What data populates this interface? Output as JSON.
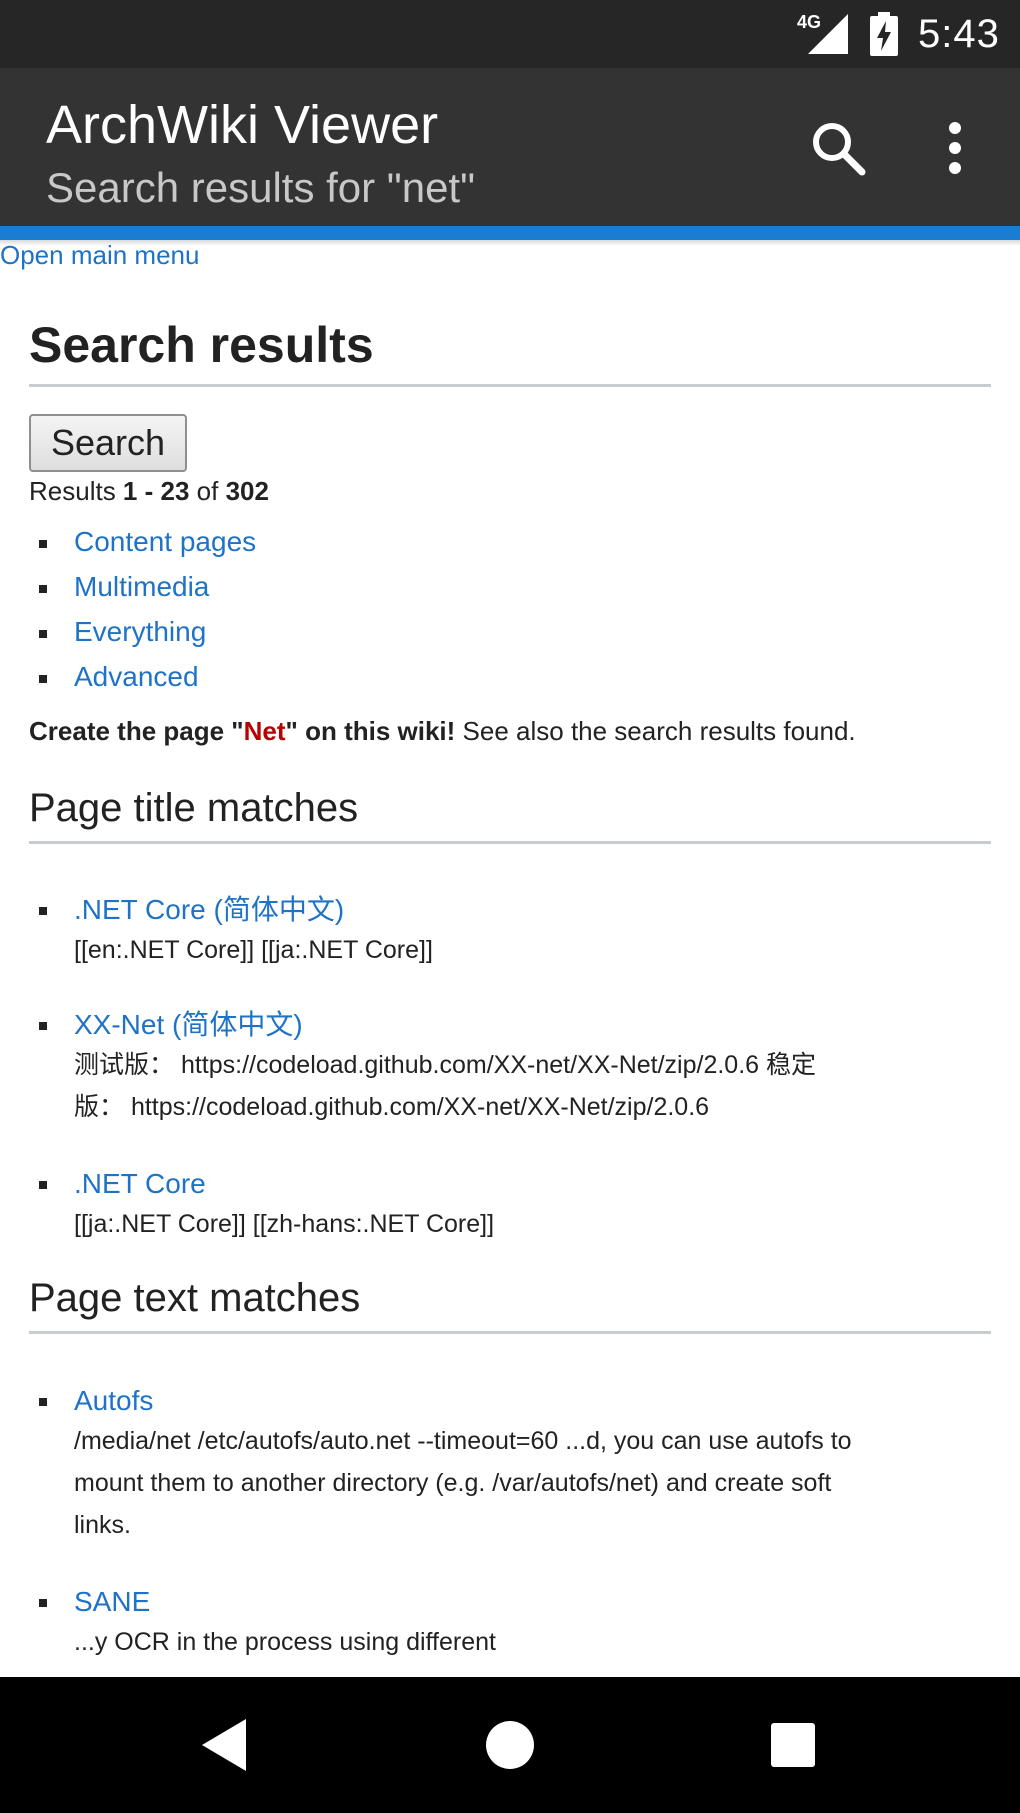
{
  "status_bar": {
    "network": "4G",
    "time": "5:43"
  },
  "app_bar": {
    "title": "ArchWiki Viewer",
    "subtitle": "Search results for \"net\"",
    "icons": [
      "search-icon",
      "more-vert-icon"
    ]
  },
  "content": {
    "open_main_menu": "Open main menu",
    "heading": "Search results",
    "search_button": "Search",
    "results": {
      "prefix": "Results ",
      "range": "1 - 23",
      "of": " of ",
      "total": "302"
    },
    "profiles": [
      {
        "label": "Content pages"
      },
      {
        "label": "Multimedia"
      },
      {
        "label": "Everything"
      },
      {
        "label": "Advanced"
      }
    ],
    "create": {
      "strong_prefix": "Create the page \"",
      "page_name": "Net",
      "strong_suffix": "\" on this wiki!",
      "rest": " See also the search results found."
    },
    "title_matches_heading": "Page title matches",
    "title_matches": [
      {
        "title": ".NET Core (简体中文)",
        "snippet_lines": [
          "[[en:.NET Core]] [[ja:.NET Core]]"
        ]
      },
      {
        "title": "XX-Net (简体中文)",
        "snippet_lines": [
          "测试版： https://codeload.github.com/XX-net/XX-Net/zip/2.0.6 稳定",
          "版： https://codeload.github.com/XX-net/XX-Net/zip/2.0.6"
        ]
      },
      {
        "title": ".NET Core",
        "snippet_lines": [
          "[[ja:.NET Core]] [[zh-hans:.NET Core]]"
        ]
      }
    ],
    "text_matches_heading": "Page text matches",
    "text_matches": [
      {
        "title": "Autofs",
        "snippet_lines": [
          "/media/net /etc/autofs/auto.net --timeout=60 ...d, you can use autofs to",
          "mount them to another directory (e.g. /var/autofs/net) and create soft",
          "links."
        ]
      },
      {
        "title": "SANE",
        "snippet_lines": [
          "...y OCR in the process using different"
        ]
      }
    ]
  },
  "nav_bar": {
    "icons": [
      "back-icon",
      "home-icon",
      "recents-icon"
    ]
  },
  "colors": {
    "status_bar": "#262626",
    "app_bar": "#333333",
    "accent": "#1a7dd1",
    "link": "#1f73c6",
    "red_link": "#ba0000"
  }
}
